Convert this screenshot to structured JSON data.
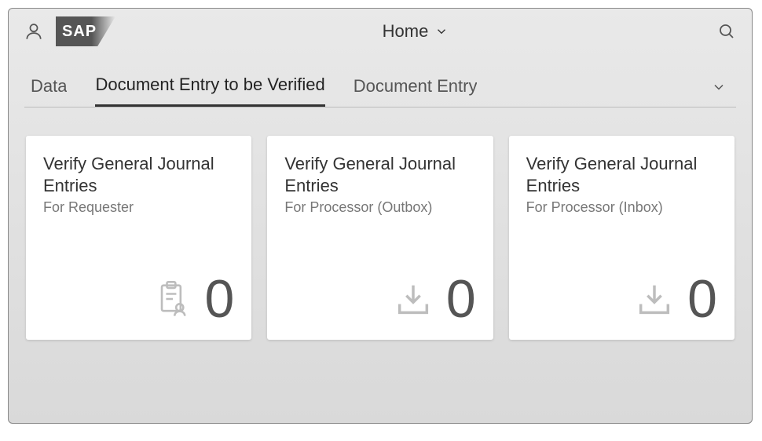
{
  "header": {
    "logo_text": "SAP",
    "page_title": "Home"
  },
  "tabs": {
    "items": [
      {
        "label": "Data"
      },
      {
        "label": "Document Entry to be Verified"
      },
      {
        "label": "Document Entry"
      }
    ],
    "active_index": 1
  },
  "tiles": [
    {
      "title": "Verify General Journal Entries",
      "subtitle": "For Requester",
      "count": "0",
      "icon": "clipboard-person"
    },
    {
      "title": "Verify General Journal Entries",
      "subtitle": "For Processor (Outbox)",
      "count": "0",
      "icon": "download-tray"
    },
    {
      "title": "Verify General Journal Entries",
      "subtitle": "For Processor (Inbox)",
      "count": "0",
      "icon": "download-tray"
    }
  ]
}
